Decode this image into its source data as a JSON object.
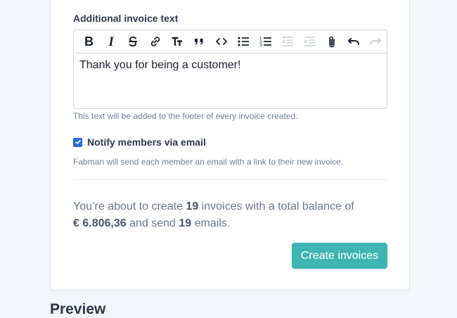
{
  "section": {
    "label": "Additional invoice text",
    "editor_text": "Thank you for being a customer!",
    "help_text": "This text will be added to the footer of every invoice created."
  },
  "toolbar": {
    "buttons": [
      {
        "icon": "bold-icon",
        "glyph": "B"
      },
      {
        "icon": "italic-icon",
        "glyph": "I"
      },
      {
        "icon": "strikethrough-icon"
      },
      {
        "icon": "link-icon"
      },
      {
        "icon": "heading-icon"
      },
      {
        "icon": "quote-icon"
      },
      {
        "icon": "code-icon"
      },
      {
        "icon": "bullet-list-icon"
      },
      {
        "icon": "numbered-list-icon"
      },
      {
        "icon": "outdent-icon",
        "disabled": true
      },
      {
        "icon": "indent-icon",
        "disabled": true
      },
      {
        "icon": "attachment-icon"
      },
      {
        "icon": "undo-icon"
      },
      {
        "icon": "redo-icon",
        "disabled": true
      }
    ]
  },
  "notify": {
    "checked": true,
    "label": "Notify members via email",
    "help_text": "Fabman will send each member an email with a link to their new invoice."
  },
  "summary": {
    "prefix": "You’re about to create ",
    "invoice_count": "19",
    "middle": " invoices with a total balance of",
    "balance": "€ 6.806,36",
    "and_send": " and send ",
    "email_count": "19",
    "suffix": " emails."
  },
  "create_button": "Create invoices",
  "preview_heading": "Preview",
  "colors": {
    "accent": "#3fb5b3",
    "checkbox": "#2b6cd6",
    "page_bg": "#f3f6fa"
  }
}
